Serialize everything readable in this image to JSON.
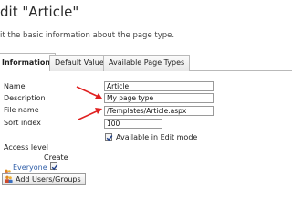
{
  "header": {
    "title": "dit \"Article\"",
    "subtitle": "it the basic information about the page type."
  },
  "tabs": [
    {
      "label": "Information",
      "active": true
    },
    {
      "label": "Default Values",
      "active": false
    },
    {
      "label": "Available Page Types",
      "active": false
    }
  ],
  "form": {
    "name_label": "Name",
    "name_value": "Article",
    "description_label": "Description",
    "description_value": "My page type",
    "filename_label": "File name",
    "filename_value": "/Templates/Article.aspx",
    "sortindex_label": "Sort index",
    "sortindex_value": "100",
    "edit_mode_label": "Available in Edit mode",
    "edit_mode_checked": true
  },
  "access": {
    "heading": "Access level",
    "column_create": "Create",
    "group_name": "Everyone",
    "create_checked": true,
    "add_button_label": "Add Users/Groups"
  },
  "colors": {
    "annotation_arrow": "#e02020",
    "link": "#2f5ea8"
  }
}
